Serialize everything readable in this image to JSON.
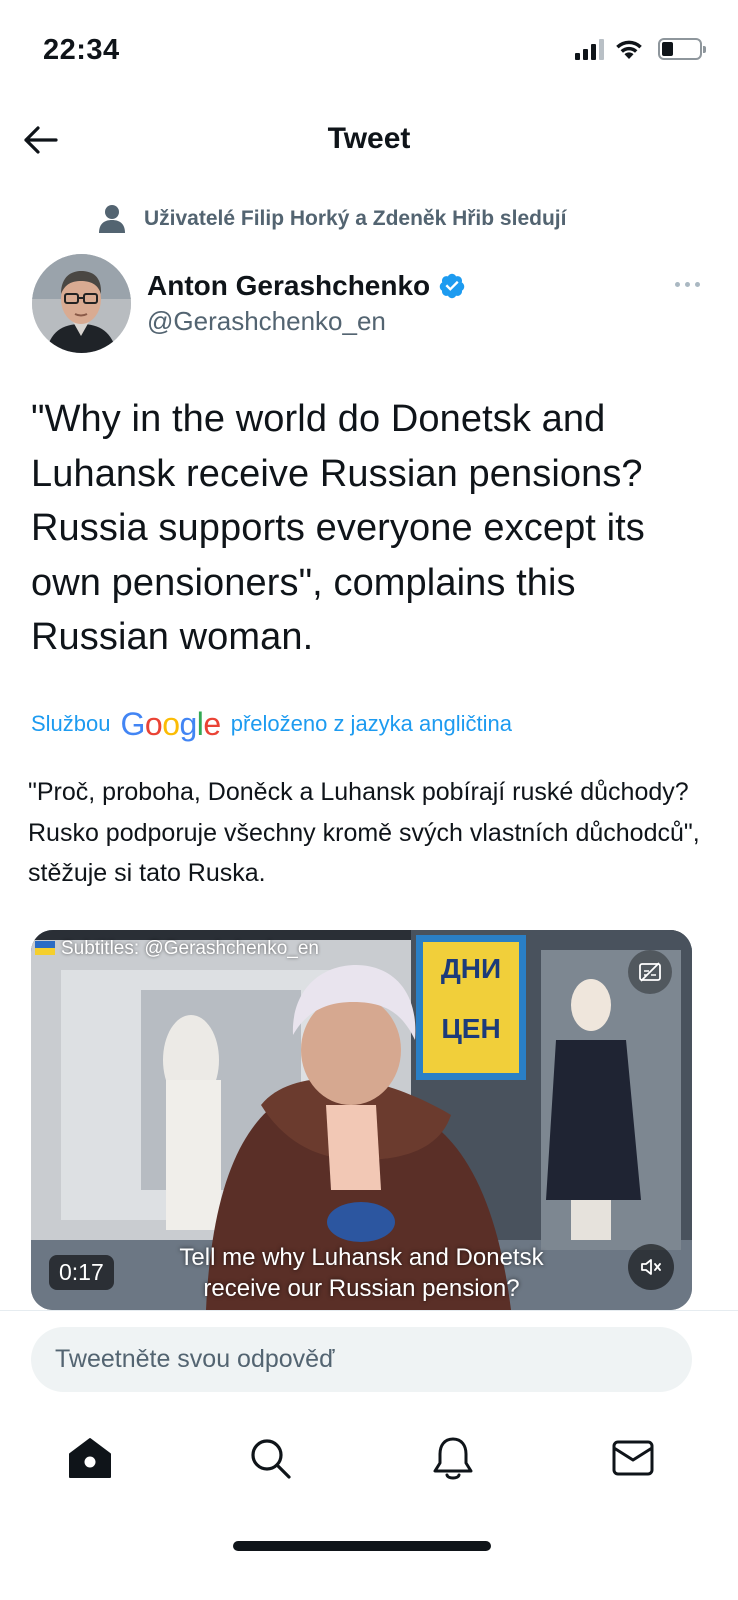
{
  "status_bar": {
    "time": "22:34",
    "battery_level": 0.3
  },
  "nav": {
    "title": "Tweet",
    "back_icon": "arrow-left-icon"
  },
  "social_context": {
    "icon": "person-icon",
    "text": "Uživatelé Filip Horký a Zdeněk Hřib sledují"
  },
  "author": {
    "name": "Anton Gerashchenko",
    "handle": "@Gerashchenko_en",
    "verified": true,
    "verified_color": "#1d9bf0"
  },
  "tweet": {
    "text": "\"Why in the world do Donetsk and Luhansk receive Russian pensions? Russia supports everyone except its own pensioners\", complains this Russian woman."
  },
  "translation": {
    "prefix": "Službou",
    "provider": "Google",
    "suffix": "přeloženo z jazyka angličtina",
    "text": "\"Proč, proboha, Doněck a Luhansk pobírají ruské důchody? Rusko podporuje všechny kromě svých vlastních důchodců\", stěžuje si tato Ruska."
  },
  "video": {
    "subtitle_credit": "Subtitles: @Gerashchenko_en",
    "sign_text_line1": "ДНИ",
    "sign_text_line2": "ЦЕН",
    "caption": "Tell me why Luhansk and Donetsk receive our Russian pension?",
    "time": "0:17"
  },
  "reply": {
    "placeholder": "Tweetněte svou odpověď"
  },
  "tab_bar": {
    "items": [
      "home-icon",
      "search-icon",
      "notifications-icon",
      "messages-icon"
    ]
  },
  "colors": {
    "accent": "#1d9bf0",
    "text": "#0f1419",
    "secondary": "#536471"
  }
}
